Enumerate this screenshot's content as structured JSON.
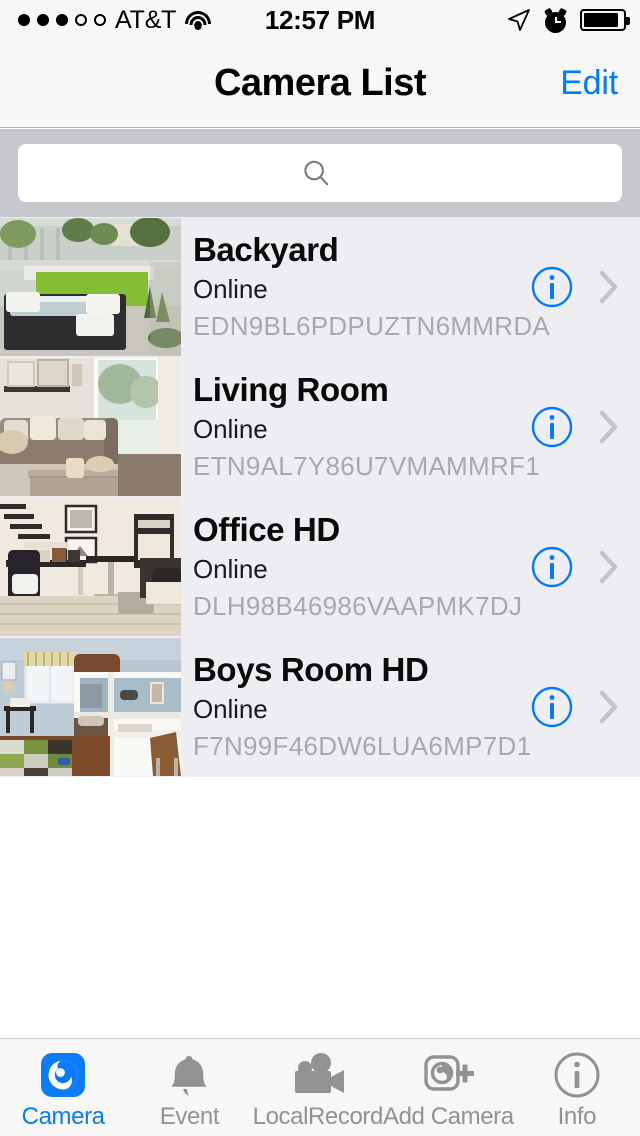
{
  "status_bar": {
    "signal_dots_filled": 3,
    "signal_dots_total": 5,
    "carrier": "AT&T",
    "wifi_icon": "wifi-icon",
    "time": "12:57 PM",
    "location_icon": "location-arrow-icon",
    "alarm_icon": "alarm-clock-icon",
    "battery_icon": "battery-icon",
    "battery_level_percent": 82
  },
  "nav": {
    "title": "Camera List",
    "edit_label": "Edit"
  },
  "search": {
    "value": "",
    "placeholder": "",
    "icon": "search-icon"
  },
  "list": {
    "info_icon": "info-circle-icon",
    "chevron_icon": "chevron-right-icon",
    "cameras": [
      {
        "name": "Backyard",
        "status": "Online",
        "uid": "EDN9BL6PDPUZTN6MMRDA",
        "thumbnail": "backyard-patio-photo"
      },
      {
        "name": "Living Room",
        "status": "Online",
        "uid": "ETN9AL7Y86U7VMAMMRF1",
        "thumbnail": "living-room-sofa-photo"
      },
      {
        "name": "Office HD",
        "status": "Online",
        "uid": "DLH98B46986VAAPMK7DJ",
        "thumbnail": "home-office-desk-photo"
      },
      {
        "name": "Boys Room HD",
        "status": "Online",
        "uid": "F7N99F46DW6LUA6MP7D1",
        "thumbnail": "boys-bunk-bed-room-photo"
      }
    ]
  },
  "tabbar": {
    "active_index": 0,
    "tabs": [
      {
        "label": "Camera",
        "icon": "camera-app-icon"
      },
      {
        "label": "Event",
        "icon": "bell-icon"
      },
      {
        "label": "LocalRecord",
        "icon": "video-camera-icon"
      },
      {
        "label": "Add Camera",
        "icon": "add-camera-icon"
      },
      {
        "label": "Info",
        "icon": "info-circle-icon"
      }
    ]
  },
  "colors": {
    "accent": "#007aff",
    "tab_active": "#0a7cf7",
    "list_bg": "#eeeef2",
    "bar_bg": "#f7f7f7",
    "search_bg": "#c7c8cd",
    "uid_text": "#a8a8ad"
  }
}
